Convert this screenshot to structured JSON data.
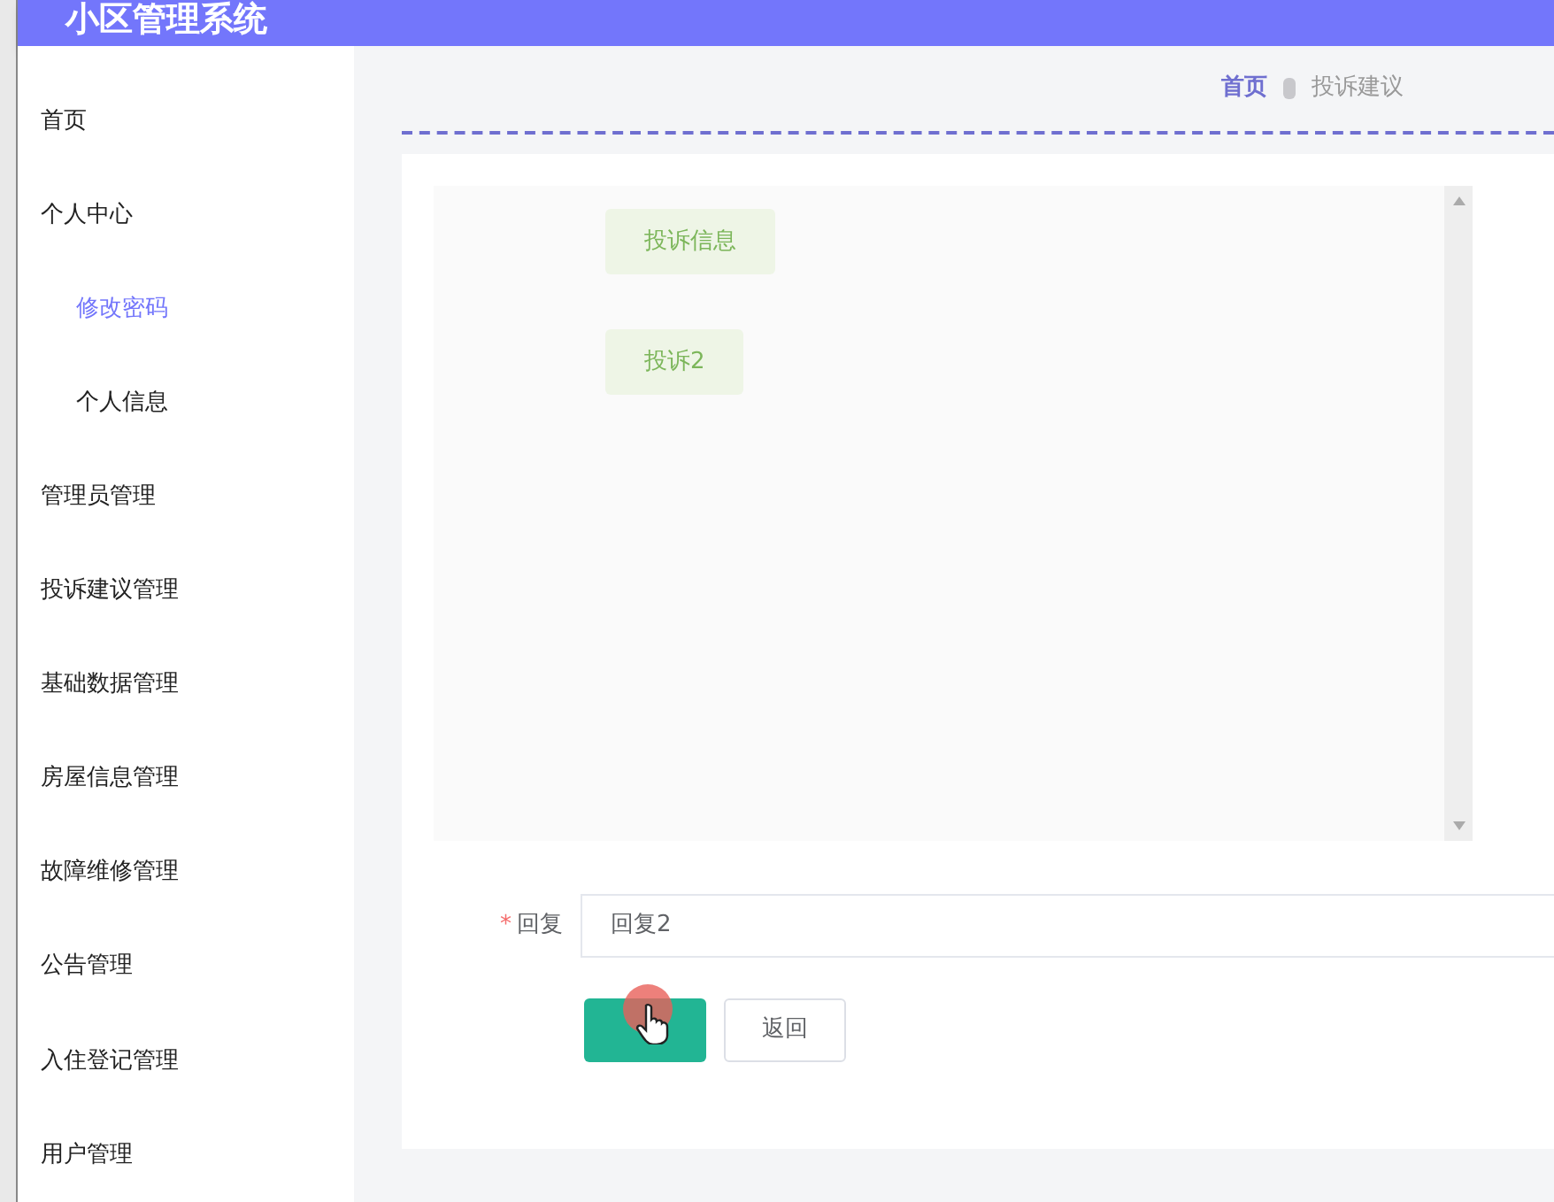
{
  "header": {
    "title": "小区管理系统"
  },
  "sidebar": {
    "items": [
      {
        "label": "首页",
        "selected": false
      },
      {
        "label": "个人中心",
        "selected": false,
        "children": [
          {
            "label": "修改密码",
            "selected": true
          },
          {
            "label": "个人信息",
            "selected": false
          }
        ]
      },
      {
        "label": "管理员管理",
        "selected": false
      },
      {
        "label": "投诉建议管理",
        "selected": false
      },
      {
        "label": "基础数据管理",
        "selected": false
      },
      {
        "label": "房屋信息管理",
        "selected": false
      },
      {
        "label": "故障维修管理",
        "selected": false
      },
      {
        "label": "公告管理",
        "selected": false
      },
      {
        "label": "入住登记管理",
        "selected": false
      },
      {
        "label": "用户管理",
        "selected": false
      }
    ]
  },
  "breadcrumb": [
    "首页",
    "投诉建议"
  ],
  "messages": [
    "投诉信息",
    "投诉2"
  ],
  "form": {
    "label": "回复",
    "required_mark": "*",
    "value": "回复2"
  },
  "buttons": [
    {
      "kind": "primary"
    },
    {
      "kind": "default",
      "label": "返回"
    }
  ]
}
